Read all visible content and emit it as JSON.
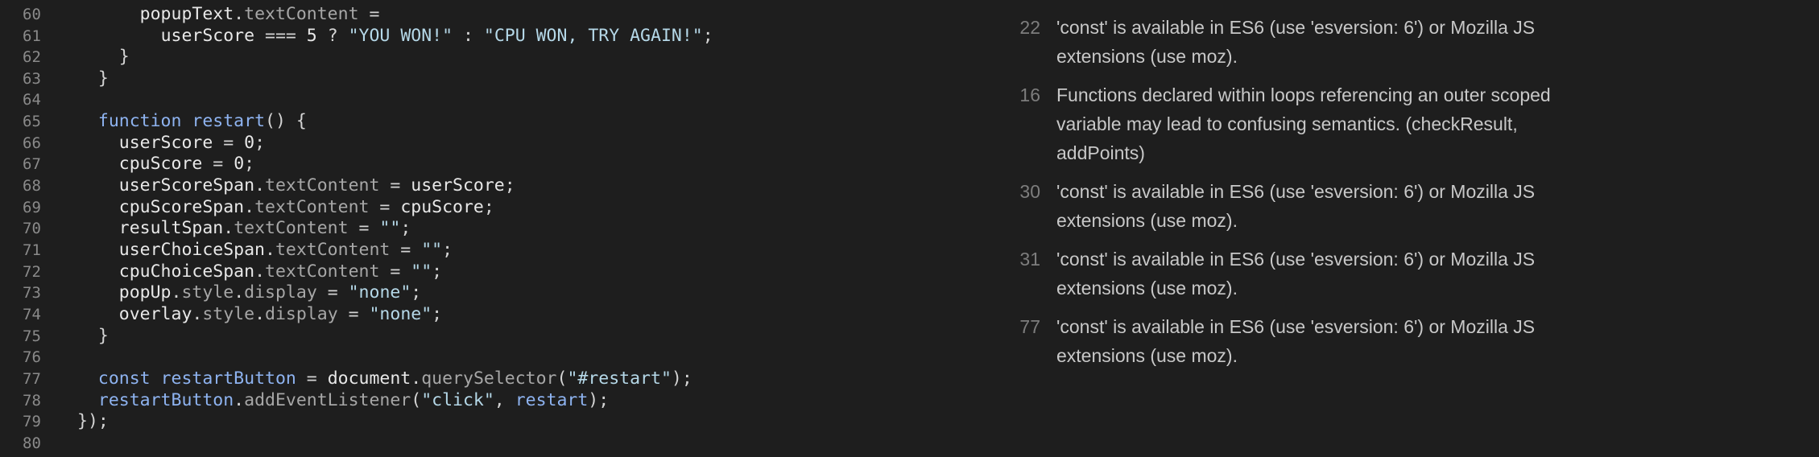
{
  "editor": {
    "lines": [
      {
        "num": "60",
        "html": "      <span class='v'>popupText</span>.<span class='p'>textContent</span> ="
      },
      {
        "num": "61",
        "html": "        <span class='v'>userScore</span> === <span class='n'>5</span> ? <span class='s'>\"YOU WON!\"</span> : <span class='s'>\"CPU WON, TRY AGAIN!\"</span>;"
      },
      {
        "num": "62",
        "html": "    }"
      },
      {
        "num": "63",
        "html": "  }"
      },
      {
        "num": "64",
        "html": ""
      },
      {
        "num": "65",
        "html": "  <span class='k'>function</span> <span class='f'>restart</span>() {"
      },
      {
        "num": "66",
        "html": "    <span class='v'>userScore</span> = <span class='n'>0</span>;"
      },
      {
        "num": "67",
        "html": "    <span class='v'>cpuScore</span> = <span class='n'>0</span>;"
      },
      {
        "num": "68",
        "html": "    <span class='v'>userScoreSpan</span>.<span class='p'>textContent</span> = <span class='v'>userScore</span>;"
      },
      {
        "num": "69",
        "html": "    <span class='v'>cpuScoreSpan</span>.<span class='p'>textContent</span> = <span class='v'>cpuScore</span>;"
      },
      {
        "num": "70",
        "html": "    <span class='v'>resultSpan</span>.<span class='p'>textContent</span> = <span class='s'>\"\"</span>;"
      },
      {
        "num": "71",
        "html": "    <span class='v'>userChoiceSpan</span>.<span class='p'>textContent</span> = <span class='s'>\"\"</span>;"
      },
      {
        "num": "72",
        "html": "    <span class='v'>cpuChoiceSpan</span>.<span class='p'>textContent</span> = <span class='s'>\"\"</span>;"
      },
      {
        "num": "73",
        "html": "    <span class='v'>popUp</span>.<span class='p'>style</span>.<span class='p'>display</span> = <span class='s'>\"none\"</span>;"
      },
      {
        "num": "74",
        "html": "    <span class='v'>overlay</span>.<span class='p'>style</span>.<span class='p'>display</span> = <span class='s'>\"none\"</span>;"
      },
      {
        "num": "75",
        "html": "  }"
      },
      {
        "num": "76",
        "html": ""
      },
      {
        "num": "77",
        "html": "  <span class='k'>const</span> <span class='f'>restartButton</span> = <span class='v'>document</span>.<span class='p'>querySelector</span>(<span class='s'>\"#restart\"</span>);"
      },
      {
        "num": "78",
        "html": "  <span class='f'>restartButton</span>.<span class='p'>addEventListener</span>(<span class='s'>\"click\"</span>, <span class='f'>restart</span>);"
      },
      {
        "num": "79",
        "html": "});"
      },
      {
        "num": "80",
        "html": ""
      }
    ]
  },
  "lint": {
    "issues": [
      {
        "line": "22",
        "message": "'const' is available in ES6 (use 'esversion: 6') or Mozilla JS extensions (use moz)."
      },
      {
        "line": "16",
        "message": "Functions declared within loops referencing an outer scoped variable may lead to confusing semantics. (checkResult, addPoints)"
      },
      {
        "line": "30",
        "message": "'const' is available in ES6 (use 'esversion: 6') or Mozilla JS extensions (use moz)."
      },
      {
        "line": "31",
        "message": "'const' is available in ES6 (use 'esversion: 6') or Mozilla JS extensions (use moz)."
      },
      {
        "line": "77",
        "message": "'const' is available in ES6 (use 'esversion: 6') or Mozilla JS extensions (use moz)."
      }
    ]
  }
}
